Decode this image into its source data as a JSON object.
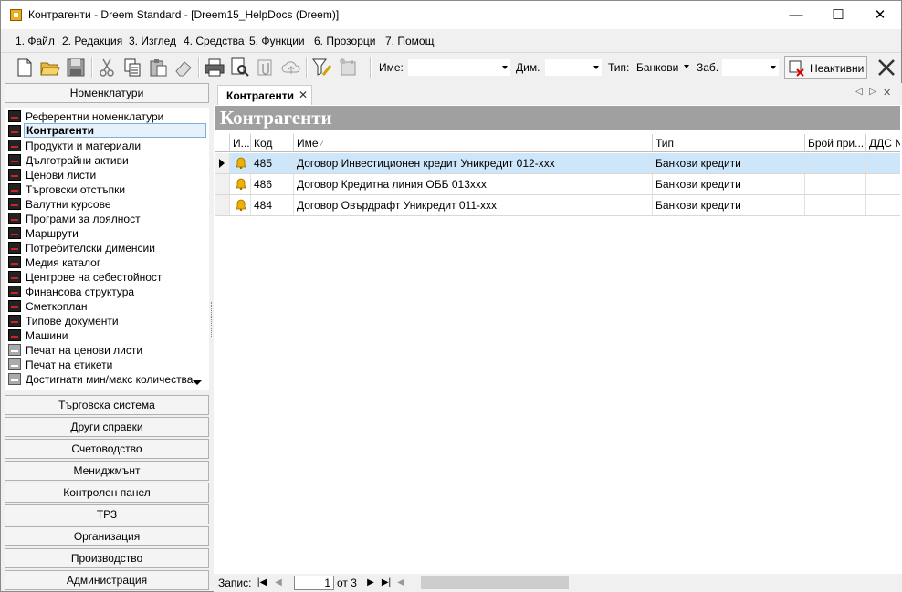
{
  "window": {
    "title": "Контрагенти - Dreem Standard - [Dreem15_HelpDocs (Dreem)]",
    "minimize": "—",
    "maximize": "☐",
    "close": "✕"
  },
  "menu": [
    {
      "label": "1. Файл"
    },
    {
      "label": "2. Редакция"
    },
    {
      "label": "3. Изглед"
    },
    {
      "label": "4. Средства"
    },
    {
      "label": "5. Функции"
    },
    {
      "label": "6. Прозорци"
    },
    {
      "label": "7. Помощ"
    }
  ],
  "toolbar": {
    "name_label": "Име:",
    "dim_label": "Дим.",
    "type_label": "Тип:",
    "type_value": "Банкови",
    "zab_label": "Заб.",
    "inactive_label": "Неактивни"
  },
  "sidebar": {
    "header": "Номенклатури",
    "items": [
      {
        "label": "Референтни номенклатури"
      },
      {
        "label": "Контрагенти"
      },
      {
        "label": "Продукти и материали"
      },
      {
        "label": "Дълготрайни активи"
      },
      {
        "label": "Ценови листи"
      },
      {
        "label": "Търговски отстъпки"
      },
      {
        "label": "Валутни курсове"
      },
      {
        "label": "Програми за лоялност"
      },
      {
        "label": "Маршрути"
      },
      {
        "label": "Потребителски дименсии"
      },
      {
        "label": "Медия каталог"
      },
      {
        "label": "Центрове на себестойност"
      },
      {
        "label": "Финансова структура"
      },
      {
        "label": "Сметкоплан"
      },
      {
        "label": "Типове документи"
      },
      {
        "label": "Машини"
      },
      {
        "label": "Печат на ценови листи"
      },
      {
        "label": "Печат на етикети"
      },
      {
        "label": "Достигнати мин/макс количества"
      }
    ],
    "sections": [
      {
        "label": "Търговска система"
      },
      {
        "label": "Други справки"
      },
      {
        "label": "Счетоводство"
      },
      {
        "label": "Мениджмънт"
      },
      {
        "label": "Контролен панел"
      },
      {
        "label": "ТРЗ"
      },
      {
        "label": "Организация"
      },
      {
        "label": "Производство"
      },
      {
        "label": "Администрация"
      }
    ]
  },
  "tab": {
    "label": "Контрагенти",
    "close": "✕"
  },
  "panel_title": "Контрагенти",
  "grid": {
    "columns": [
      {
        "label": "И..."
      },
      {
        "label": "Код"
      },
      {
        "label": "Име"
      },
      {
        "label": "Тип"
      },
      {
        "label": "Брой при..."
      },
      {
        "label": "ДДС N"
      }
    ],
    "rows": [
      {
        "code": "485",
        "name": "Договор Инвестиционен кредит Уникредит 012-ххх",
        "type": "Банкови кредити",
        "selected": true
      },
      {
        "code": "486",
        "name": "Договор Кредитна линия ОББ 013ххх",
        "type": "Банкови кредити",
        "selected": false
      },
      {
        "code": "484",
        "name": "Договор Овърдрафт Уникредит 011-ххх",
        "type": "Банкови кредити",
        "selected": false
      }
    ]
  },
  "status": {
    "record_label": "Запис:",
    "record_value": "1",
    "of_label": "от 3"
  }
}
